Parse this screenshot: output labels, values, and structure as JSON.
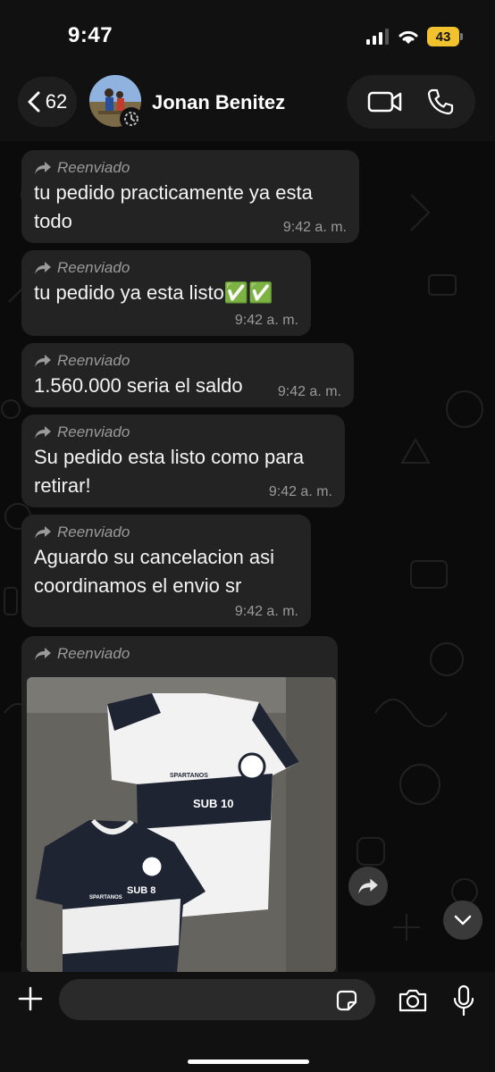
{
  "status": {
    "time": "9:47",
    "battery": "43"
  },
  "header": {
    "back_count": "62",
    "contact_name": "Jonan Benitez"
  },
  "messages": [
    {
      "forwarded_label": "Reenviado",
      "text": "tu pedido practicamente ya esta todo",
      "time": "9:42 a. m."
    },
    {
      "forwarded_label": "Reenviado",
      "text": "tu pedido ya esta listo✅✅",
      "time": "9:42 a. m."
    },
    {
      "forwarded_label": "Reenviado",
      "text": "1.560.000 seria el saldo",
      "time": "9:42 a. m."
    },
    {
      "forwarded_label": "Reenviado",
      "text": "Su pedido esta listo como para retirar!",
      "time": "9:42 a. m."
    },
    {
      "forwarded_label": "Reenviado",
      "text": "Aguardo su cancelacion asi coordinamos el envio sr",
      "time": "9:42 a. m."
    },
    {
      "forwarded_label": "Reenviado"
    }
  ],
  "photo": {
    "shirt1_label": "SUB 10",
    "shirt2_label": "SUB 8",
    "brand": "SPARTANOS"
  },
  "composer": {
    "placeholder": ""
  },
  "colors": {
    "bubble": "#232323",
    "background": "#0b0b0b",
    "battery": "#f2c12e"
  },
  "icons": [
    "signal-icon",
    "wifi-icon",
    "chevron-left-icon",
    "video-call-icon",
    "phone-icon",
    "forward-icon",
    "chevron-down-icon",
    "plus-icon",
    "sticker-icon",
    "camera-icon",
    "mic-icon"
  ]
}
